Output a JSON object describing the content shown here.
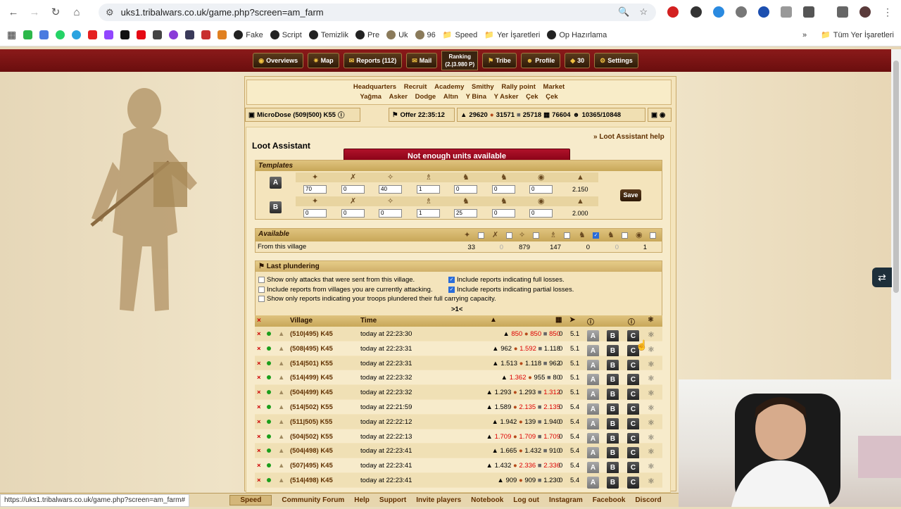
{
  "browser": {
    "url": "uks1.tribalwars.co.uk/game.php?screen=am_farm",
    "bookmarks": [
      "Fake",
      "Script",
      "Temizlik",
      "Pre",
      "Uk",
      "96",
      "Speed",
      "Yer İşaretleri",
      "Op Hazırlama"
    ],
    "all_bookmarks": "Tüm Yer İşaretleri",
    "status_url": "https://uks1.tribalwars.co.uk/game.php?screen=am_farm#"
  },
  "nav": {
    "overviews": "Overviews",
    "map": "Map",
    "reports": "Reports (112)",
    "mail": "Mail",
    "ranking_label": "Ranking",
    "ranking_value": "(2.|3.980 P)",
    "tribe": "Tribe",
    "profile": "Profile",
    "count": "30",
    "settings": "Settings"
  },
  "buildings": {
    "row1": [
      "Headquarters",
      "Recruit",
      "Academy",
      "Smithy",
      "Rally point",
      "Market"
    ],
    "row2": [
      "Yağma",
      "Asker",
      "Dodge",
      "Altın",
      "Y Bina",
      "Y Asker",
      "Çek",
      "Çek"
    ]
  },
  "village_bar": {
    "village": "MicroDose (509|500) K55",
    "offer": "Offer 22:35:12",
    "wood": "29620",
    "clay": "31571",
    "iron": "25718",
    "storage": "76604",
    "pop": "10365/10848"
  },
  "title": "Loot Assistant",
  "help": "» Loot Assistant help",
  "error": "Not enough units available",
  "templates": {
    "header": "Templates",
    "a": {
      "label": "A",
      "values": [
        "70",
        "0",
        "40",
        "1",
        "0",
        "0",
        "0"
      ],
      "capacity": "2.150"
    },
    "b": {
      "label": "B",
      "values": [
        "0",
        "0",
        "0",
        "1",
        "25",
        "0",
        "0"
      ],
      "capacity": "2.000"
    },
    "save": "Save"
  },
  "available": {
    "header": "Available",
    "row_label": "From this village",
    "values": [
      "33",
      "0",
      "879",
      "147",
      "0",
      "0",
      "1"
    ]
  },
  "last": {
    "header": "Last plundering",
    "opt1": "Show only attacks that were sent from this village.",
    "opt2": "Include reports from villages you are currently attacking.",
    "opt3": "Show only reports indicating your troops plundered their full carrying capacity.",
    "opt4": "Include reports indicating full losses.",
    "opt5": "Include reports indicating partial losses.",
    "pager": ">1<",
    "col_village": "Village",
    "col_time": "Time"
  },
  "rows": [
    {
      "v": "(510|495) K45",
      "t": "today at 22:23:30",
      "w": "850",
      "c": "850",
      "i": "850",
      "wr": true,
      "cr": true,
      "ir": true,
      "wall": "0",
      "dist": "5.1"
    },
    {
      "v": "(508|495) K45",
      "t": "today at 22:23:31",
      "w": "962",
      "c": "1.592",
      "i": "1.118",
      "wr": false,
      "cr": true,
      "ir": false,
      "wall": "0",
      "dist": "5.1"
    },
    {
      "v": "(514|501) K55",
      "t": "today at 22:23:31",
      "w": "1.513",
      "c": "1.118",
      "i": "962",
      "wr": false,
      "cr": false,
      "ir": false,
      "wall": "0",
      "dist": "5.1"
    },
    {
      "v": "(514|499) K45",
      "t": "today at 22:23:32",
      "w": "1.362",
      "c": "955",
      "i": "80",
      "wr": true,
      "cr": false,
      "ir": false,
      "wall": "0",
      "dist": "5.1"
    },
    {
      "v": "(504|499) K45",
      "t": "today at 22:23:32",
      "w": "1.293",
      "c": "1.293",
      "i": "1.312",
      "wr": false,
      "cr": false,
      "ir": true,
      "wall": "0",
      "dist": "5.1"
    },
    {
      "v": "(514|502) K55",
      "t": "today at 22:21:59",
      "w": "1.589",
      "c": "2.135",
      "i": "2.135",
      "wr": false,
      "cr": true,
      "ir": true,
      "wall": "0",
      "dist": "5.4"
    },
    {
      "v": "(511|505) K55",
      "t": "today at 22:22:12",
      "w": "1.942",
      "c": "139",
      "i": "1.940",
      "wr": false,
      "cr": false,
      "ir": false,
      "wall": "0",
      "dist": "5.4"
    },
    {
      "v": "(504|502) K55",
      "t": "today at 22:22:13",
      "w": "1.709",
      "c": "1.709",
      "i": "1.709",
      "wr": true,
      "cr": true,
      "ir": true,
      "wall": "0",
      "dist": "5.4"
    },
    {
      "v": "(504|498) K45",
      "t": "today at 22:23:41",
      "w": "1.665",
      "c": "1.432",
      "i": "910",
      "wr": false,
      "cr": false,
      "ir": false,
      "wall": "0",
      "dist": "5.4"
    },
    {
      "v": "(507|495) K45",
      "t": "today at 22:23:41",
      "w": "1.432",
      "c": "2.336",
      "i": "2.336",
      "wr": false,
      "cr": true,
      "ir": true,
      "wall": "0",
      "dist": "5.4"
    },
    {
      "v": "(514|498) K45",
      "t": "today at 22:23:41",
      "w": "909",
      "c": "909",
      "i": "1.230",
      "wr": false,
      "cr": false,
      "ir": false,
      "wall": "0",
      "dist": "5.4"
    }
  ],
  "buttons": {
    "a": "A",
    "b": "B",
    "c": "C"
  },
  "footer": [
    "Speed",
    "Community Forum",
    "Help",
    "Support",
    "Invite players",
    "Notebook",
    "Log out",
    "Instagram",
    "Facebook",
    "Discord"
  ]
}
